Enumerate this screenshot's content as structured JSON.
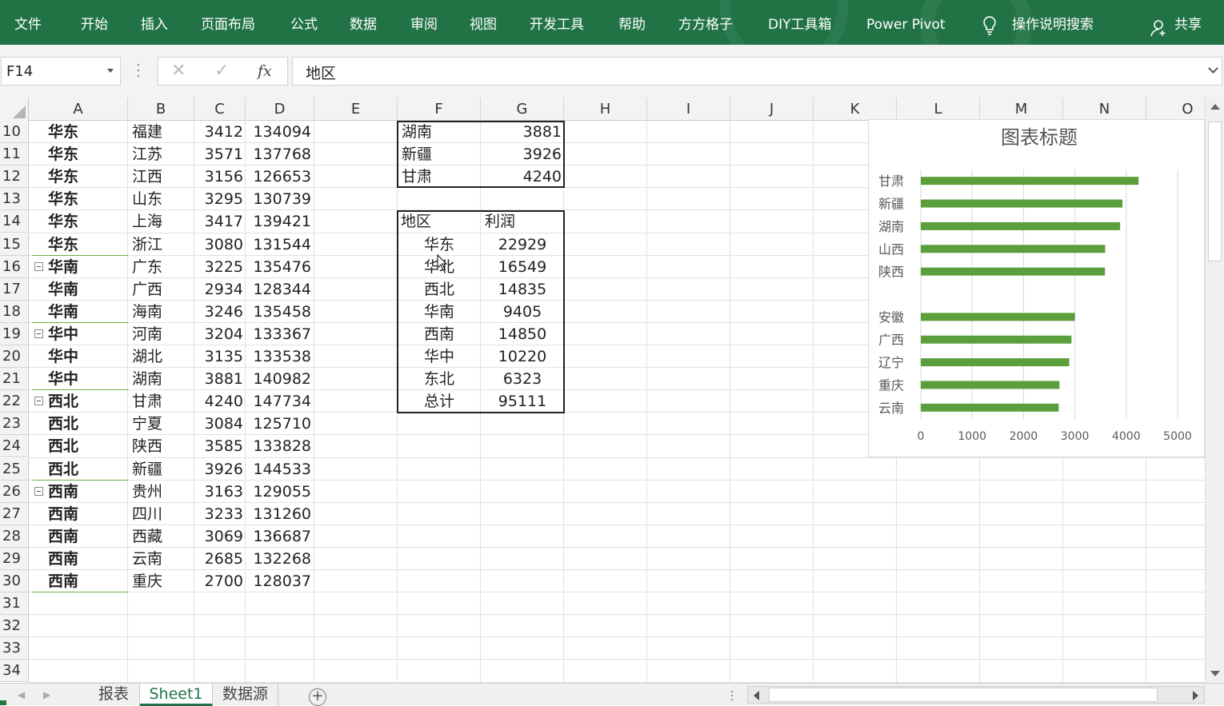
{
  "ribbon": {
    "tabs": [
      "文件",
      "开始",
      "插入",
      "页面布局",
      "公式",
      "数据",
      "审阅",
      "视图",
      "开发工具",
      "帮助",
      "方方格子",
      "DIY工具箱",
      "Power Pivot"
    ],
    "search_label": "操作说明搜索",
    "share_label": "共享"
  },
  "formula_bar": {
    "name_box": "F14",
    "fx_label": "fx",
    "content": "地区"
  },
  "columns": [
    "A",
    "B",
    "C",
    "D",
    "E",
    "F",
    "G",
    "H",
    "I",
    "J",
    "K",
    "L",
    "M",
    "N",
    "O"
  ],
  "rows": [
    {
      "num": "10",
      "a": "华东",
      "b": "福建",
      "c": "3412",
      "d": "134094",
      "collapse": false
    },
    {
      "num": "11",
      "a": "华东",
      "b": "江苏",
      "c": "3571",
      "d": "137768",
      "collapse": false
    },
    {
      "num": "12",
      "a": "华东",
      "b": "江西",
      "c": "3156",
      "d": "126653",
      "collapse": false
    },
    {
      "num": "13",
      "a": "华东",
      "b": "山东",
      "c": "3295",
      "d": "130739",
      "collapse": false
    },
    {
      "num": "14",
      "a": "华东",
      "b": "上海",
      "c": "3417",
      "d": "139421",
      "collapse": false
    },
    {
      "num": "15",
      "a": "华东",
      "b": "浙江",
      "c": "3080",
      "d": "131544",
      "collapse": false
    },
    {
      "num": "16",
      "a": "华南",
      "b": "广东",
      "c": "3225",
      "d": "135476",
      "collapse": true
    },
    {
      "num": "17",
      "a": "华南",
      "b": "广西",
      "c": "2934",
      "d": "128344",
      "collapse": false
    },
    {
      "num": "18",
      "a": "华南",
      "b": "海南",
      "c": "3246",
      "d": "135458",
      "collapse": false
    },
    {
      "num": "19",
      "a": "华中",
      "b": "河南",
      "c": "3204",
      "d": "133367",
      "collapse": true
    },
    {
      "num": "20",
      "a": "华中",
      "b": "湖北",
      "c": "3135",
      "d": "133538",
      "collapse": false
    },
    {
      "num": "21",
      "a": "华中",
      "b": "湖南",
      "c": "3881",
      "d": "140982",
      "collapse": false
    },
    {
      "num": "22",
      "a": "西北",
      "b": "甘肃",
      "c": "4240",
      "d": "147734",
      "collapse": true
    },
    {
      "num": "23",
      "a": "西北",
      "b": "宁夏",
      "c": "3084",
      "d": "125710",
      "collapse": false
    },
    {
      "num": "24",
      "a": "西北",
      "b": "陕西",
      "c": "3585",
      "d": "133828",
      "collapse": false
    },
    {
      "num": "25",
      "a": "西北",
      "b": "新疆",
      "c": "3926",
      "d": "144533",
      "collapse": false
    },
    {
      "num": "26",
      "a": "西南",
      "b": "贵州",
      "c": "3163",
      "d": "129055",
      "collapse": true
    },
    {
      "num": "27",
      "a": "西南",
      "b": "四川",
      "c": "3233",
      "d": "131260",
      "collapse": false
    },
    {
      "num": "28",
      "a": "西南",
      "b": "西藏",
      "c": "3069",
      "d": "136687",
      "collapse": false
    },
    {
      "num": "29",
      "a": "西南",
      "b": "云南",
      "c": "2685",
      "d": "132268",
      "collapse": false
    },
    {
      "num": "30",
      "a": "西南",
      "b": "重庆",
      "c": "2700",
      "d": "128037",
      "collapse": false
    },
    {
      "num": "31"
    },
    {
      "num": "32"
    },
    {
      "num": "33"
    },
    {
      "num": "34"
    }
  ],
  "top_table": [
    {
      "name": "湖南",
      "value": "3881"
    },
    {
      "name": "新疆",
      "value": "3926"
    },
    {
      "name": "甘肃",
      "value": "4240"
    }
  ],
  "pivot": {
    "header_region": "地区",
    "header_profit": "利润",
    "rows": [
      {
        "region": "华东",
        "profit": "22929"
      },
      {
        "region": "华北",
        "profit": "16549"
      },
      {
        "region": "西北",
        "profit": "14835"
      },
      {
        "region": "华南",
        "profit": "9405"
      },
      {
        "region": "西南",
        "profit": "14850"
      },
      {
        "region": "华中",
        "profit": "10220"
      },
      {
        "region": "东北",
        "profit": "6323"
      }
    ],
    "total_label": "总计",
    "total_value": "95111"
  },
  "chart_data": {
    "type": "bar",
    "orientation": "horizontal",
    "title": "图表标题",
    "categories": [
      "甘肃",
      "新疆",
      "湖南",
      "山西",
      "陕西",
      "",
      "安徽",
      "广西",
      "辽宁",
      "重庆",
      "云南"
    ],
    "values": [
      4240,
      3926,
      3881,
      3590,
      3585,
      null,
      3000,
      2934,
      2890,
      2700,
      2685
    ],
    "xlim": [
      0,
      5000
    ],
    "xticks": [
      "0",
      "1000",
      "2000",
      "3000",
      "4000",
      "5000"
    ],
    "grid": true,
    "bar_color": "#5b9f3c"
  },
  "sheet_tabs": [
    "报表",
    "Sheet1",
    "数据源"
  ],
  "active_sheet": "Sheet1",
  "colors": {
    "ribbon": "#217346",
    "outline": "#70ad47"
  }
}
